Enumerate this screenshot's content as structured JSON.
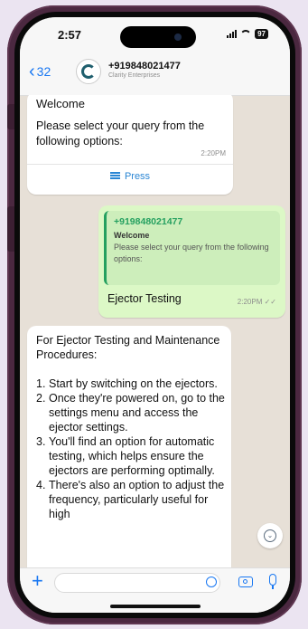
{
  "status_bar": {
    "time": "2:57",
    "battery": "97"
  },
  "header": {
    "back_count": "32",
    "contact_number": "+919848021477",
    "contact_subtitle": "Clarity Enterprises"
  },
  "messages": {
    "incoming_1": {
      "title": "Welcome",
      "body": "Please select your query from the following options:",
      "time": "2:20PM",
      "button_label": "Press"
    },
    "outgoing_1": {
      "quoted_name": "+919848021477",
      "quoted_title": "Welcome",
      "quoted_body": "Please select your query from the following options:",
      "text": "Ejector Testing",
      "time": "2:20PM"
    },
    "incoming_2": {
      "intro": "For Ejector Testing and Maintenance Procedures:",
      "steps": [
        {
          "num": "1.",
          "text": "Start by switching on the ejectors."
        },
        {
          "num": "2.",
          "text": "Once they're powered on, go to the settings menu and access the ejector settings."
        },
        {
          "num": "3.",
          "text": "You'll find an option for automatic testing, which helps ensure the ejectors are performing optimally."
        },
        {
          "num": "4.",
          "text": "There's also an option to adjust the frequency, particularly useful for high"
        }
      ]
    }
  },
  "icons": {
    "back": "chevron-left-icon",
    "menu": "list-icon",
    "scroll": "chevron-down-icon",
    "attach": "plus-icon",
    "sticker": "sticker-icon",
    "camera": "camera-icon",
    "mic": "microphone-icon"
  },
  "colors": {
    "accent": "#1877f2",
    "outgoing_bubble": "#dcf8c6",
    "quote_bar": "#25a060",
    "chat_background": "#e7e0d7"
  }
}
